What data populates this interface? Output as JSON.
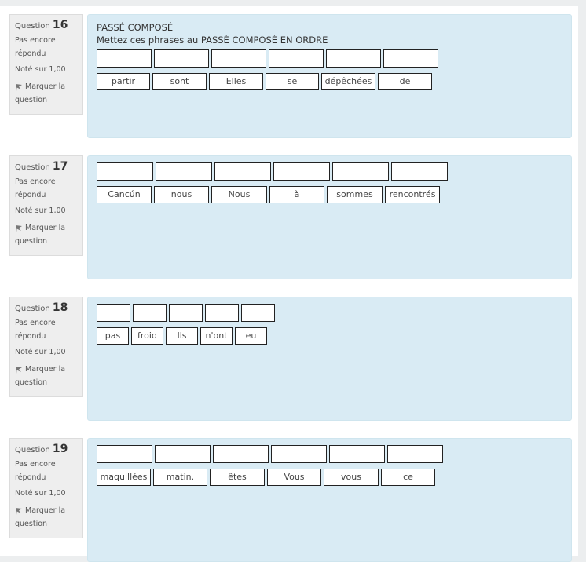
{
  "questions": [
    {
      "label": "Question",
      "number": "16",
      "state_line1": "Pas encore",
      "state_line2": "répondu",
      "grade": "Noté sur 1,00",
      "flag_line1": "Marquer la",
      "flag_line2": "question",
      "title": "PASSÉ COMPOSÉ",
      "instruction": "Mettez ces phrases au PASSÉ COMPOSÉ EN ORDRE",
      "drop_count": 6,
      "words": [
        "partir",
        "sont",
        "Elles",
        "se",
        "dépêchées",
        "de"
      ]
    },
    {
      "label": "Question",
      "number": "17",
      "state_line1": "Pas encore",
      "state_line2": "répondu",
      "grade": "Noté sur 1,00",
      "flag_line1": "Marquer la",
      "flag_line2": "question",
      "words": [
        "Cancún",
        "nous",
        "Nous",
        "à",
        "sommes",
        "rencontrés"
      ],
      "drop_count": 6
    },
    {
      "label": "Question",
      "number": "18",
      "state_line1": "Pas encore",
      "state_line2": "répondu",
      "grade": "Noté sur 1,00",
      "flag_line1": "Marquer la",
      "flag_line2": "question",
      "words": [
        "pas",
        "froid",
        "Ils",
        "n'ont",
        "eu"
      ],
      "drop_count": 5
    },
    {
      "label": "Question",
      "number": "19",
      "state_line1": "Pas encore",
      "state_line2": "répondu",
      "grade": "Noté sur 1,00",
      "flag_line1": "Marquer la",
      "flag_line2": "question",
      "words": [
        "maquillées",
        "matin.",
        "êtes",
        "Vous",
        "vous",
        "ce"
      ],
      "drop_count": 6
    }
  ],
  "icons": {
    "flag": "flag-icon"
  },
  "colors": {
    "content_bg": "#d9ebf4",
    "info_bg": "#eeeeee"
  }
}
